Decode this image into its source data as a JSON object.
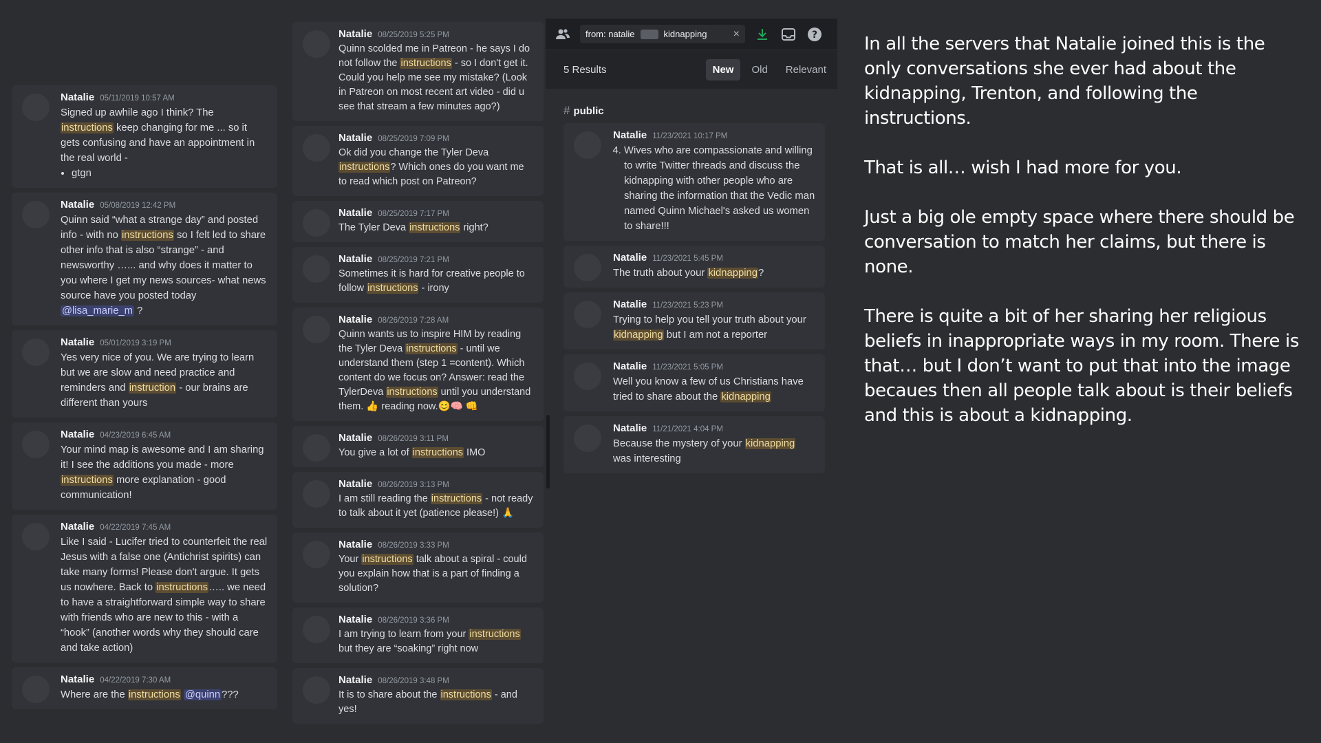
{
  "left_column": [
    {
      "author": "Natalie",
      "time": "05/11/2019 10:57 AM",
      "segments": [
        {
          "t": "Signed up awhile ago I think?  The "
        },
        {
          "t": "instructions",
          "hl": true
        },
        {
          "t": " keep changing for me ... so it gets confusing and have an appointment in the real world -"
        }
      ],
      "bullet": "gtgn"
    },
    {
      "author": "Natalie",
      "time": "05/08/2019 12:42 PM",
      "segments": [
        {
          "t": "Quinn said “what a strange day” and posted info - with no "
        },
        {
          "t": "instructions",
          "hl": true
        },
        {
          "t": " so I felt led to share other info that is also “strange” - and newsworthy …... and why does it matter to you where I get my news sources- what news source have you posted today "
        },
        {
          "t": "@lisa_marie_m",
          "mention": true
        },
        {
          "t": " ?"
        }
      ]
    },
    {
      "author": "Natalie",
      "time": "05/01/2019 3:19 PM",
      "segments": [
        {
          "t": "Yes very nice of you.  We are trying to learn but we are slow and need practice and reminders and "
        },
        {
          "t": "instruction",
          "hl": true
        },
        {
          "t": " - our brains are different than yours"
        }
      ]
    },
    {
      "author": "Natalie",
      "time": "04/23/2019 6:45 AM",
      "segments": [
        {
          "t": "Your mind map is awesome and I am sharing it!  I see the additions you made - more "
        },
        {
          "t": "instructions",
          "hl": true
        },
        {
          "t": " more explanation - good communication!"
        }
      ]
    },
    {
      "author": "Natalie",
      "time": "04/22/2019 7:45 AM",
      "segments": [
        {
          "t": "Like I said - Lucifer tried to counterfeit the real Jesus with a false one (Antichrist spirits) can take many forms!  Please don't argue.  It gets us nowhere.  Back to "
        },
        {
          "t": "instructions",
          "hl": true
        },
        {
          "t": "….. we need to have a straightforward simple way to share with friends who are new to this - with a “hook” (another words why they should care and take action)"
        }
      ]
    },
    {
      "author": "Natalie",
      "time": "04/22/2019 7:30 AM",
      "segments": [
        {
          "t": "Where are the "
        },
        {
          "t": "instructions",
          "hl": true
        },
        {
          "t": " "
        },
        {
          "t": "@quinn",
          "mention": true
        },
        {
          "t": "???"
        }
      ]
    }
  ],
  "middle_column": [
    {
      "author": "Natalie",
      "time": "08/25/2019 5:25 PM",
      "segments": [
        {
          "t": "Quinn scolded me in Patreon - he says I do not follow the "
        },
        {
          "t": "instructions",
          "hl": true
        },
        {
          "t": " - so I don't get it.  Could you help me see my mistake? (Look in Patreon on most recent art video - did u see that stream a few minutes ago?)"
        }
      ]
    },
    {
      "author": "Natalie",
      "time": "08/25/2019 7:09 PM",
      "segments": [
        {
          "t": "Ok did you change the Tyler Deva "
        },
        {
          "t": "instructions",
          "hl": true
        },
        {
          "t": "?  Which ones do you want me to read  which post on Patreon?"
        }
      ]
    },
    {
      "author": "Natalie",
      "time": "08/25/2019 7:17 PM",
      "segments": [
        {
          "t": "The Tyler Deva "
        },
        {
          "t": "instructions",
          "hl": true
        },
        {
          "t": " right?"
        }
      ]
    },
    {
      "author": "Natalie",
      "time": "08/25/2019 7:21 PM",
      "segments": [
        {
          "t": "Sometimes it is hard for creative people to follow "
        },
        {
          "t": "instructions",
          "hl": true
        },
        {
          "t": " - irony"
        }
      ]
    },
    {
      "author": "Natalie",
      "time": "08/26/2019 7:28 AM",
      "segments": [
        {
          "t": "Quinn wants us to inspire HIM by reading the Tyler Deva "
        },
        {
          "t": "instructions",
          "hl": true
        },
        {
          "t": " - until we understand them (step 1 =content). Which content do we focus on?  Answer: read the TylerDeva "
        },
        {
          "t": "instructions",
          "hl": true
        },
        {
          "t": " until you understand them. 👍 reading now.😊🧠 👊"
        }
      ]
    },
    {
      "author": "Natalie",
      "time": "08/26/2019 3:11 PM",
      "segments": [
        {
          "t": "You give a lot of "
        },
        {
          "t": "instructions",
          "hl": true
        },
        {
          "t": " IMO"
        }
      ]
    },
    {
      "author": "Natalie",
      "time": "08/26/2019 3:13 PM",
      "segments": [
        {
          "t": "I am still reading the "
        },
        {
          "t": "instructions",
          "hl": true
        },
        {
          "t": " - not ready to talk about it yet (patience please!) 🙏"
        }
      ]
    },
    {
      "author": "Natalie",
      "time": "08/26/2019 3:33 PM",
      "segments": [
        {
          "t": "Your "
        },
        {
          "t": "instructions",
          "hl": true
        },
        {
          "t": " talk about a spiral - could you explain how that is a part of finding a solution?"
        }
      ]
    },
    {
      "author": "Natalie",
      "time": "08/26/2019 3:36 PM",
      "segments": [
        {
          "t": "I am trying to learn from your "
        },
        {
          "t": "instructions",
          "hl": true
        },
        {
          "t": " but they are “soaking” right now"
        }
      ]
    },
    {
      "author": "Natalie",
      "time": "08/26/2019 3:48 PM",
      "segments": [
        {
          "t": "It is to share about the "
        },
        {
          "t": "instructions",
          "hl": true
        },
        {
          "t": " - and yes!"
        }
      ]
    }
  ],
  "search": {
    "query_prefix": "from: natalie",
    "query_term": "kidnapping",
    "clear_glyph": "×",
    "results_count": "5 Results",
    "tabs": [
      "New",
      "Old",
      "Relevant"
    ],
    "active_tab": "New",
    "channel": "public",
    "results": [
      {
        "author": "Natalie",
        "time": "11/23/2021 10:17 PM",
        "list_number": 4,
        "segments": [
          {
            "t": "Wives who are compassionate and willing to write Twitter threads and discuss the kidnapping with other people who are sharing the information that the Vedic man named Quinn Michael's asked us women to share!!!"
          }
        ]
      },
      {
        "author": "Natalie",
        "time": "11/23/2021 5:45 PM",
        "segments": [
          {
            "t": "The truth about your "
          },
          {
            "t": "kidnapping",
            "hl": true
          },
          {
            "t": "?"
          }
        ]
      },
      {
        "author": "Natalie",
        "time": "11/23/2021 5:23 PM",
        "segments": [
          {
            "t": "Trying to help you tell your truth about your "
          },
          {
            "t": "kidnapping",
            "hl": true
          },
          {
            "t": " but I am not a reporter"
          }
        ]
      },
      {
        "author": "Natalie",
        "time": "11/23/2021 5:05 PM",
        "segments": [
          {
            "t": "Well you know a few of us Christians have tried to share about the "
          },
          {
            "t": "kidnapping",
            "hl": true
          }
        ]
      },
      {
        "author": "Natalie",
        "time": "11/21/2021 4:04 PM",
        "segments": [
          {
            "t": "Because the mystery of your "
          },
          {
            "t": "kidnapping",
            "hl": true
          },
          {
            "t": " was interesting"
          }
        ]
      }
    ]
  },
  "narrative": {
    "p1": "In all the servers that Natalie joined this is the only conversations she ever had about the kidnapping, Trenton, and following the instructions.",
    "p2": "That is all… wish I had more for you.",
    "p3": "Just a big ole empty space where there should be conversation to match her claims, but there is none.",
    "p4": "There is quite a bit of her sharing her religious beliefs in inappropriate ways in my room. There is that… but I don’t want to put that into the image becaues then all people talk about is their beliefs and this is about a kidnapping."
  },
  "icons": {
    "members": "members-icon",
    "download": "download-icon",
    "inbox": "inbox-icon",
    "help": "help-icon"
  },
  "colors": {
    "background": "#2b2d31",
    "card": "#313338",
    "highlight": "#5c4d32",
    "mention": "#3c4270",
    "download": "#23a55a"
  }
}
